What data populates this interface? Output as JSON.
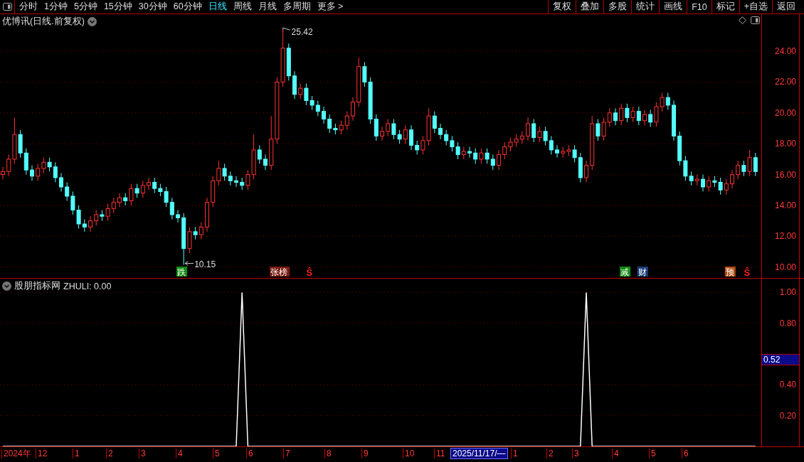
{
  "toolbar": {
    "tabs": [
      {
        "label": "分时",
        "selected": false
      },
      {
        "label": "1分钟",
        "selected": false
      },
      {
        "label": "5分钟",
        "selected": false
      },
      {
        "label": "15分钟",
        "selected": false
      },
      {
        "label": "30分钟",
        "selected": false
      },
      {
        "label": "60分钟",
        "selected": false
      },
      {
        "label": "日线",
        "selected": true
      },
      {
        "label": "周线",
        "selected": false
      },
      {
        "label": "月线",
        "selected": false
      },
      {
        "label": "多周期",
        "selected": false
      },
      {
        "label": "更多 >",
        "selected": false
      }
    ],
    "buttons": [
      "复权",
      "叠加",
      "多股",
      "统计",
      "画线",
      "F10",
      "标记",
      "+自选",
      "返回"
    ]
  },
  "price_pane": {
    "title": "优博讯(日线.前复权)",
    "chart_data": {
      "type": "candlestick",
      "yticks": [
        {
          "value": 24,
          "label": "24.00"
        },
        {
          "value": 22,
          "label": "22.00"
        },
        {
          "value": 20,
          "label": "20.00"
        },
        {
          "value": 18,
          "label": "18.00"
        },
        {
          "value": 16,
          "label": "16.00"
        },
        {
          "value": 14,
          "label": "14.00"
        },
        {
          "value": 12,
          "label": "12.00"
        },
        {
          "value": 10,
          "label": "10.00"
        }
      ],
      "ylim": [
        9.3,
        26.4
      ],
      "grid": true,
      "ohlc": [
        [
          16.0,
          16.5,
          15.7,
          16.2
        ],
        [
          16.2,
          17.3,
          15.9,
          17.0
        ],
        [
          17.0,
          19.7,
          16.7,
          18.6
        ],
        [
          18.6,
          18.9,
          17.1,
          17.4
        ],
        [
          17.4,
          17.7,
          16.0,
          16.3
        ],
        [
          16.3,
          16.6,
          15.6,
          15.9
        ],
        [
          15.9,
          16.7,
          15.6,
          16.4
        ],
        [
          16.4,
          17.1,
          16.1,
          16.8
        ],
        [
          16.8,
          17.1,
          16.2,
          16.5
        ],
        [
          16.5,
          16.8,
          15.5,
          15.8
        ],
        [
          15.8,
          16.1,
          14.9,
          15.2
        ],
        [
          15.2,
          15.5,
          14.3,
          14.6
        ],
        [
          14.6,
          14.9,
          13.4,
          13.7
        ],
        [
          13.7,
          14.0,
          12.5,
          12.8
        ],
        [
          12.8,
          13.1,
          12.3,
          12.6
        ],
        [
          12.6,
          13.3,
          12.3,
          13.0
        ],
        [
          13.0,
          13.7,
          12.7,
          13.4
        ],
        [
          13.4,
          13.7,
          13.0,
          13.3
        ],
        [
          13.3,
          14.1,
          13.0,
          13.8
        ],
        [
          13.8,
          14.5,
          13.5,
          14.2
        ],
        [
          14.2,
          14.8,
          13.9,
          14.5
        ],
        [
          14.5,
          14.8,
          14.0,
          14.3
        ],
        [
          14.3,
          15.4,
          14.0,
          15.1
        ],
        [
          15.1,
          15.4,
          14.5,
          14.8
        ],
        [
          14.8,
          15.6,
          14.5,
          15.3
        ],
        [
          15.3,
          15.8,
          15.0,
          15.5
        ],
        [
          15.5,
          15.8,
          14.8,
          15.1
        ],
        [
          15.1,
          15.4,
          14.6,
          14.9
        ],
        [
          14.9,
          15.2,
          13.9,
          14.2
        ],
        [
          14.2,
          14.5,
          13.1,
          13.4
        ],
        [
          13.4,
          13.7,
          12.9,
          13.2
        ],
        [
          13.2,
          13.5,
          10.15,
          11.2
        ],
        [
          11.2,
          12.6,
          10.9,
          12.3
        ],
        [
          12.3,
          12.6,
          11.8,
          12.1
        ],
        [
          12.1,
          12.9,
          11.8,
          12.6
        ],
        [
          12.6,
          14.5,
          12.3,
          14.2
        ],
        [
          14.2,
          15.9,
          13.9,
          15.6
        ],
        [
          15.6,
          16.9,
          15.3,
          16.4
        ],
        [
          16.4,
          16.7,
          15.6,
          15.9
        ],
        [
          15.9,
          16.2,
          15.3,
          15.6
        ],
        [
          15.6,
          15.9,
          15.2,
          15.5
        ],
        [
          15.5,
          15.8,
          15.0,
          15.3
        ],
        [
          15.3,
          16.3,
          15.0,
          16.0
        ],
        [
          16.0,
          18.6,
          15.7,
          17.6
        ],
        [
          17.6,
          17.9,
          16.7,
          17.0
        ],
        [
          17.0,
          17.3,
          16.3,
          16.6
        ],
        [
          16.6,
          19.8,
          16.3,
          18.3
        ],
        [
          18.3,
          22.3,
          18.0,
          22.0
        ],
        [
          22.0,
          25.42,
          21.7,
          24.2
        ],
        [
          24.2,
          24.5,
          22.1,
          22.4
        ],
        [
          22.4,
          22.7,
          20.9,
          21.2
        ],
        [
          21.2,
          21.9,
          20.9,
          21.6
        ],
        [
          21.6,
          21.9,
          20.5,
          20.8
        ],
        [
          20.8,
          21.1,
          20.2,
          20.5
        ],
        [
          20.5,
          20.8,
          19.8,
          20.1
        ],
        [
          20.1,
          20.4,
          19.3,
          19.6
        ],
        [
          19.6,
          19.9,
          18.7,
          19.0
        ],
        [
          19.0,
          19.3,
          18.6,
          18.9
        ],
        [
          18.9,
          19.5,
          18.6,
          19.2
        ],
        [
          19.2,
          20.1,
          18.9,
          19.8
        ],
        [
          19.8,
          21.0,
          19.5,
          20.7
        ],
        [
          20.7,
          23.6,
          20.4,
          23.0
        ],
        [
          23.0,
          23.3,
          21.7,
          22.0
        ],
        [
          22.0,
          22.3,
          19.3,
          19.6
        ],
        [
          19.6,
          19.9,
          18.2,
          18.5
        ],
        [
          18.5,
          19.1,
          18.2,
          18.8
        ],
        [
          18.8,
          19.6,
          18.5,
          19.3
        ],
        [
          19.3,
          19.6,
          18.3,
          18.6
        ],
        [
          18.6,
          18.9,
          18.0,
          18.3
        ],
        [
          18.3,
          19.2,
          18.0,
          18.9
        ],
        [
          18.9,
          19.2,
          17.6,
          17.9
        ],
        [
          17.9,
          18.2,
          17.3,
          17.6
        ],
        [
          17.6,
          18.5,
          17.3,
          18.2
        ],
        [
          18.2,
          20.3,
          17.9,
          19.8
        ],
        [
          19.8,
          20.1,
          18.7,
          19.0
        ],
        [
          19.0,
          19.3,
          18.3,
          18.6
        ],
        [
          18.6,
          18.9,
          17.9,
          18.2
        ],
        [
          18.2,
          18.5,
          17.5,
          17.8
        ],
        [
          17.8,
          18.1,
          17.0,
          17.3
        ],
        [
          17.3,
          17.8,
          17.0,
          17.5
        ],
        [
          17.5,
          17.8,
          17.1,
          17.4
        ],
        [
          17.4,
          17.7,
          16.7,
          17.0
        ],
        [
          17.0,
          17.7,
          16.7,
          17.4
        ],
        [
          17.4,
          17.7,
          16.7,
          17.0
        ],
        [
          17.0,
          17.3,
          16.3,
          16.6
        ],
        [
          16.6,
          17.6,
          16.3,
          17.3
        ],
        [
          17.3,
          18.1,
          17.0,
          17.8
        ],
        [
          17.8,
          18.4,
          17.5,
          18.1
        ],
        [
          18.1,
          18.6,
          17.8,
          18.3
        ],
        [
          18.3,
          18.8,
          18.0,
          18.5
        ],
        [
          18.5,
          19.7,
          18.2,
          19.3
        ],
        [
          19.3,
          19.6,
          18.1,
          18.4
        ],
        [
          18.4,
          19.1,
          18.1,
          18.8
        ],
        [
          18.8,
          19.1,
          17.9,
          18.2
        ],
        [
          18.2,
          18.5,
          17.3,
          17.6
        ],
        [
          17.6,
          17.9,
          17.1,
          17.4
        ],
        [
          17.4,
          17.8,
          17.1,
          17.5
        ],
        [
          17.5,
          17.9,
          17.2,
          17.6
        ],
        [
          17.6,
          17.9,
          16.8,
          17.1
        ],
        [
          17.1,
          17.4,
          15.5,
          15.8
        ],
        [
          15.8,
          16.9,
          15.5,
          16.6
        ],
        [
          16.6,
          19.8,
          16.3,
          19.3
        ],
        [
          19.3,
          19.6,
          18.2,
          18.5
        ],
        [
          18.5,
          19.7,
          18.2,
          19.4
        ],
        [
          19.4,
          20.3,
          19.1,
          20.0
        ],
        [
          20.0,
          20.3,
          19.2,
          19.5
        ],
        [
          19.5,
          20.6,
          19.2,
          20.3
        ],
        [
          20.3,
          20.6,
          19.4,
          19.7
        ],
        [
          19.7,
          20.4,
          19.4,
          20.1
        ],
        [
          20.1,
          20.4,
          19.2,
          19.5
        ],
        [
          19.5,
          20.2,
          19.2,
          19.9
        ],
        [
          19.9,
          20.2,
          19.1,
          19.4
        ],
        [
          19.4,
          20.7,
          19.1,
          20.4
        ],
        [
          20.4,
          21.3,
          20.1,
          21.0
        ],
        [
          21.0,
          21.3,
          20.2,
          20.5
        ],
        [
          20.5,
          20.8,
          18.2,
          18.5
        ],
        [
          18.5,
          18.8,
          16.6,
          16.9
        ],
        [
          16.9,
          17.2,
          15.6,
          15.9
        ],
        [
          15.9,
          16.2,
          15.3,
          15.6
        ],
        [
          15.6,
          16.0,
          15.3,
          15.7
        ],
        [
          15.7,
          16.0,
          14.9,
          15.2
        ],
        [
          15.2,
          15.9,
          14.9,
          15.6
        ],
        [
          15.6,
          15.9,
          15.2,
          15.5
        ],
        [
          15.5,
          15.8,
          14.7,
          15.0
        ],
        [
          15.0,
          15.7,
          14.7,
          15.4
        ],
        [
          15.4,
          16.3,
          15.1,
          16.0
        ],
        [
          16.0,
          16.9,
          15.7,
          16.6
        ],
        [
          16.6,
          16.9,
          15.9,
          16.2
        ],
        [
          16.2,
          17.6,
          15.9,
          17.1
        ],
        [
          17.1,
          17.4,
          15.9,
          16.2
        ]
      ],
      "annotations": [
        "25.42",
        "10.15"
      ]
    },
    "markers": [
      {
        "kind": "badge",
        "text": "跌",
        "color": "#138a13"
      },
      {
        "kind": "badge",
        "text": "张榜",
        "color": "#7a1a10"
      },
      {
        "kind": "signal",
        "text": "Ŝ",
        "color": "#ff2020"
      },
      {
        "kind": "badge",
        "text": "减",
        "color": "#138a13"
      },
      {
        "kind": "badge",
        "text": "财",
        "color": "#1c3c78"
      },
      {
        "kind": "badge",
        "text": "预",
        "color": "#b04a10"
      },
      {
        "kind": "signal",
        "text": "Ŝ",
        "color": "#ff2020"
      }
    ]
  },
  "indicator_pane": {
    "source": "股朋指标网",
    "reading": "ZHULI: 0.00",
    "cursor_value": "0.52",
    "chart_data": {
      "type": "line",
      "ylim": [
        0,
        1.09
      ],
      "grid": true,
      "yticks": [
        {
          "value": 1,
          "label": "1.00"
        },
        {
          "value": 0.8,
          "label": "0.80"
        },
        {
          "value": 0.4,
          "label": "0.40"
        },
        {
          "value": 0.2,
          "label": "0.20"
        }
      ],
      "series": [
        {
          "color": "#ffffff",
          "values": [
            0,
            0,
            0,
            0,
            0,
            0,
            0,
            0,
            0,
            0,
            0,
            0,
            0,
            0,
            0,
            0,
            0,
            0,
            0,
            0,
            0,
            0,
            0,
            0,
            0,
            0,
            0,
            0,
            0,
            0,
            0,
            0,
            0,
            0,
            0,
            0,
            0,
            0,
            0,
            0,
            0,
            1,
            0,
            0,
            0,
            0,
            0,
            0,
            0,
            0,
            0,
            0,
            0,
            0,
            0,
            0,
            0,
            0,
            0,
            0,
            0,
            0,
            0,
            0,
            0,
            0,
            0,
            0,
            0,
            0,
            0,
            0,
            0,
            0,
            0,
            0,
            0,
            0,
            0,
            0,
            0,
            0,
            0,
            0,
            0,
            0,
            0,
            0,
            0,
            0,
            0,
            0,
            0,
            0,
            0,
            0,
            0,
            0,
            0,
            0,
            1,
            0,
            0,
            0,
            0,
            0,
            0,
            0,
            0,
            0,
            0,
            0,
            0,
            0,
            0,
            0,
            0,
            0,
            0,
            0,
            0,
            0,
            0,
            0,
            0,
            0,
            0,
            0,
            0,
            0
          ]
        }
      ]
    }
  },
  "date_axis": {
    "labels": [
      "2024年",
      "12",
      "1",
      "2",
      "3",
      "4",
      "5",
      "6",
      "7",
      "8",
      "9",
      "10",
      "11",
      "1",
      "2",
      "3",
      "4",
      "5",
      "6"
    ],
    "cursor_date": "2025/11/17/—"
  }
}
